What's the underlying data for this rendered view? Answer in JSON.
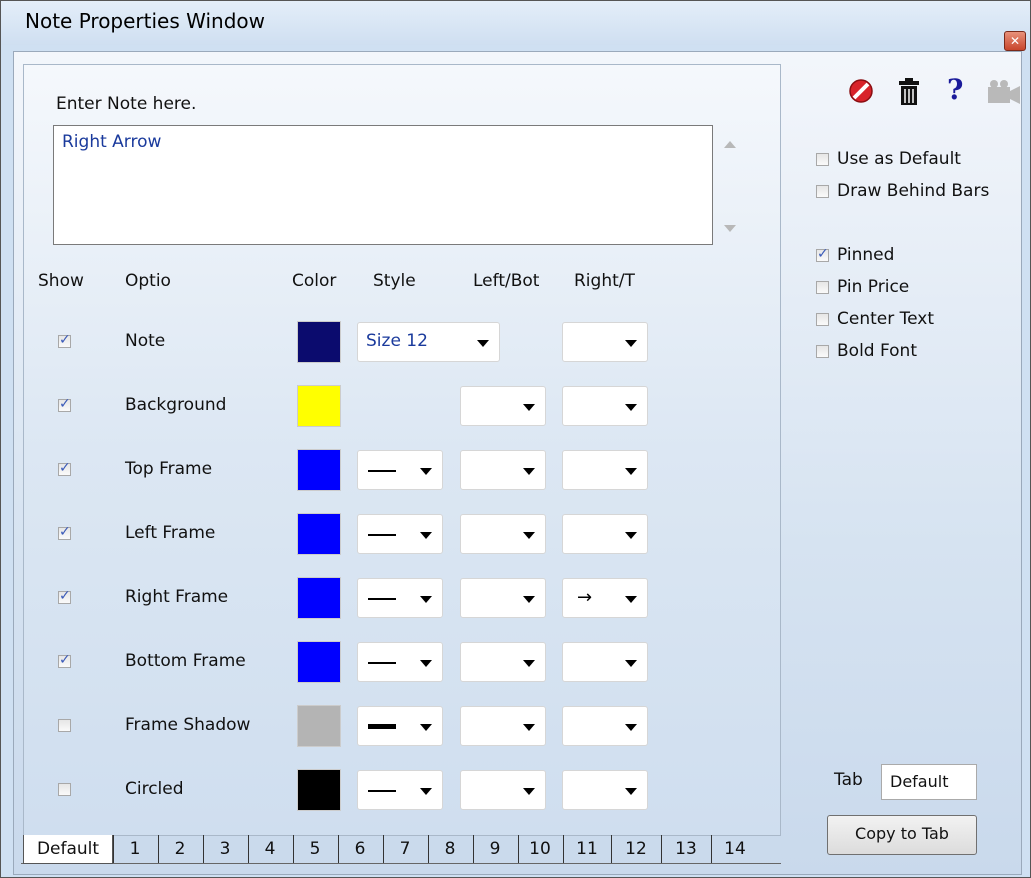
{
  "window": {
    "title": "Note Properties Window"
  },
  "toolbar": {
    "icons": [
      "stop-icon",
      "trash-icon",
      "help-icon",
      "camera-icon"
    ],
    "help_label": "?"
  },
  "note": {
    "label": "Enter Note here.",
    "value": "Right Arrow"
  },
  "headers": {
    "show": "Show",
    "option": "Optio",
    "color": "Color",
    "style": "Style",
    "left": "Left/Bot",
    "right": "Right/T"
  },
  "rows": [
    {
      "show": true,
      "option": "Note",
      "color": "#0b0b6e",
      "style": "Size 12",
      "left": null,
      "right": ""
    },
    {
      "show": true,
      "option": "Background",
      "color": "#ffff00",
      "style": null,
      "left": "",
      "right": ""
    },
    {
      "show": true,
      "option": "Top Frame",
      "color": "#0000ff",
      "style": "line",
      "left": "",
      "right": ""
    },
    {
      "show": true,
      "option": "Left Frame",
      "color": "#0000ff",
      "style": "line",
      "left": "",
      "right": ""
    },
    {
      "show": true,
      "option": "Right Frame",
      "color": "#0000ff",
      "style": "line",
      "left": "",
      "right": "→"
    },
    {
      "show": true,
      "option": "Bottom Frame",
      "color": "#0000ff",
      "style": "line",
      "left": "",
      "right": ""
    },
    {
      "show": false,
      "option": "Frame Shadow",
      "color": "#b4b4b4",
      "style": "thick-line",
      "left": "",
      "right": ""
    },
    {
      "show": false,
      "option": "Circled",
      "color": "#000000",
      "style": "line",
      "left": "",
      "right": ""
    }
  ],
  "options": [
    {
      "label": "Use as Default",
      "checked": false
    },
    {
      "label": "Draw Behind Bars",
      "checked": false
    },
    {
      "label": "Pinned",
      "checked": true
    },
    {
      "label": "Pin Price",
      "checked": false
    },
    {
      "label": "Center Text",
      "checked": false
    },
    {
      "label": "Bold Font",
      "checked": false
    }
  ],
  "tabfield": {
    "label": "Tab",
    "value": "Default"
  },
  "copy_button": "Copy to Tab",
  "tabs": [
    "Default",
    "1",
    "2",
    "3",
    "4",
    "5",
    "6",
    "7",
    "8",
    "9",
    "10",
    "11",
    "12",
    "13",
    "14"
  ]
}
